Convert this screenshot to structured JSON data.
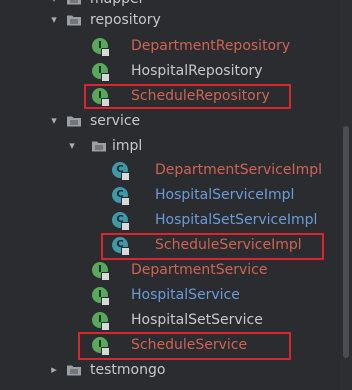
{
  "tree": {
    "nodes": [
      {
        "label": "mapper",
        "kind": "folder",
        "expanded": true
      },
      {
        "label": "repository",
        "kind": "folder",
        "expanded": true
      },
      {
        "label": "DepartmentRepository",
        "kind": "interface",
        "color": "red"
      },
      {
        "label": "HospitalRepository",
        "kind": "interface",
        "color": "white"
      },
      {
        "label": "ScheduleRepository",
        "kind": "interface",
        "color": "red",
        "highlighted": true
      },
      {
        "label": "service",
        "kind": "folder",
        "expanded": true
      },
      {
        "label": "impl",
        "kind": "folder",
        "expanded": true
      },
      {
        "label": "DepartmentServiceImpl",
        "kind": "class",
        "color": "red"
      },
      {
        "label": "HospitalServiceImpl",
        "kind": "class",
        "color": "blue"
      },
      {
        "label": "HospitalSetServiceImpl",
        "kind": "class",
        "color": "blue"
      },
      {
        "label": "ScheduleServiceImpl",
        "kind": "class",
        "color": "red",
        "highlighted": true
      },
      {
        "label": "DepartmentService",
        "kind": "interface",
        "color": "red"
      },
      {
        "label": "HospitalService",
        "kind": "interface",
        "color": "blue"
      },
      {
        "label": "HospitalSetService",
        "kind": "interface",
        "color": "white"
      },
      {
        "label": "ScheduleService",
        "kind": "interface",
        "color": "red",
        "highlighted": true
      },
      {
        "label": "testmongo",
        "kind": "folder",
        "expanded": false
      }
    ]
  },
  "icons": {
    "interface_glyph": "I",
    "class_glyph": "C",
    "expanded_arrow": "▾",
    "collapsed_arrow": "▸"
  },
  "colors": {
    "background": "#2a2c2f",
    "red_text": "#d06354",
    "white_text": "#c6c8cb",
    "blue_text": "#6b9bd8",
    "interface_icon": "#5aa75e",
    "class_icon": "#3f99a9",
    "highlight_box": "#d9262e"
  }
}
